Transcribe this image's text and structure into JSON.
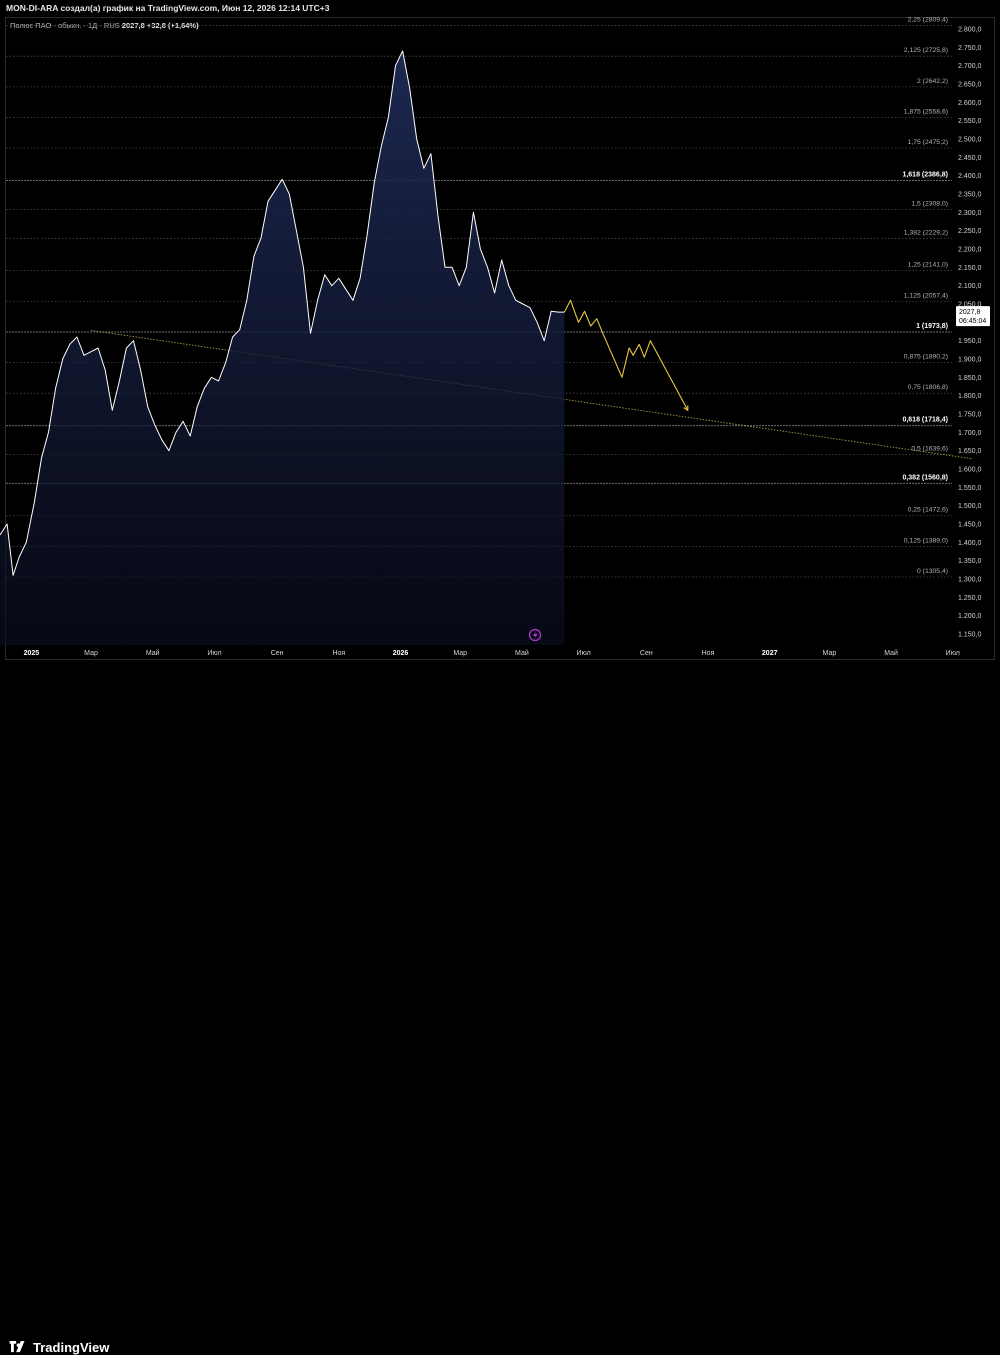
{
  "header": {
    "title": "MON-DI-ARA создал(а) график на TradingView.com, Июн 12, 2026 12:14 UTC+3"
  },
  "legend": {
    "symbol": "Полюс ПАО · обыкн. · 1Д · RUS",
    "last": "2027,8",
    "change": "+32,8 (+1,64%)"
  },
  "price_label": {
    "value": "2027,8",
    "countdown": "06:45:04"
  },
  "footer": {
    "brand": "TradingView"
  },
  "colors": {
    "background": "#000000",
    "price_line": "#ffffff",
    "area_fill_top": "#1e2a55",
    "projection": "#e8c840",
    "trendline": "#c9b448",
    "fib_line": "#3a3a3a",
    "lightning_badge": "#b539d6"
  },
  "chart_data": {
    "type": "area",
    "title": "",
    "y_axis_ticks": [
      "2.800,0",
      "2.750,0",
      "2.700,0",
      "2.650,0",
      "2.600,0",
      "2.550,0",
      "2.500,0",
      "2.450,0",
      "2.400,0",
      "2.350,0",
      "2.300,0",
      "2.250,0",
      "2.200,0",
      "2.150,0",
      "2.100,0",
      "2.050,0",
      "2.000,0",
      "1.950,0",
      "1.900,0",
      "1.850,0",
      "1.800,0",
      "1.750,0",
      "1.700,0",
      "1.650,0",
      "1.600,0",
      "1.550,0",
      "1.500,0",
      "1.450,0",
      "1.400,0",
      "1.350,0",
      "1.300,0",
      "1.250,0",
      "1.200,0",
      "1.150,0"
    ],
    "y_ticks_values": [
      2800,
      2750,
      2700,
      2650,
      2600,
      2550,
      2500,
      2450,
      2400,
      2350,
      2300,
      2250,
      2200,
      2150,
      2100,
      2050,
      2000,
      1950,
      1900,
      1850,
      1800,
      1750,
      1700,
      1650,
      1600,
      1550,
      1500,
      1450,
      1400,
      1350,
      1300,
      1250,
      1200,
      1150
    ],
    "ylim": [
      1120,
      2830
    ],
    "x_axis_labels": [
      "2025",
      "Мар",
      "Май",
      "Июл",
      "Сен",
      "Ноя",
      "2026",
      "Мар",
      "Май",
      "Июл",
      "Сен",
      "Ноя",
      "2027",
      "Мар",
      "Май",
      "Июл"
    ],
    "x_axis_label_dates": [
      "2025-01-01",
      "2025-03-01",
      "2025-05-01",
      "2025-07-01",
      "2025-09-01",
      "2025-11-01",
      "2026-01-01",
      "2026-03-01",
      "2026-05-01",
      "2026-07-01",
      "2026-09-01",
      "2026-11-01",
      "2027-01-01",
      "2027-03-01",
      "2027-05-01",
      "2027-07-01"
    ],
    "x_range": [
      "2024-12-01",
      "2027-07-20"
    ],
    "fib_levels": [
      {
        "label": "2,25 (2809,4)",
        "value": 2809.4,
        "highlight": false
      },
      {
        "label": "2,125 (2725,8)",
        "value": 2725.8,
        "highlight": false
      },
      {
        "label": "2 (2642,2)",
        "value": 2642.2,
        "highlight": false
      },
      {
        "label": "1,875 (2558,6)",
        "value": 2558.6,
        "highlight": false
      },
      {
        "label": "1,75 (2475,2)",
        "value": 2475.2,
        "highlight": false
      },
      {
        "label": "1,618 (2386,8)",
        "value": 2386.8,
        "highlight": true
      },
      {
        "label": "1,5 (2308,0)",
        "value": 2308.0,
        "highlight": false
      },
      {
        "label": "1,382 (2229,2)",
        "value": 2229.2,
        "highlight": false
      },
      {
        "label": "1,25 (2141,0)",
        "value": 2141.0,
        "highlight": false
      },
      {
        "label": "1,125 (2057,4)",
        "value": 2057.4,
        "highlight": false
      },
      {
        "label": "1 (1973,8)",
        "value": 1973.8,
        "highlight": true
      },
      {
        "label": "0,875 (1890,2)",
        "value": 1890.2,
        "highlight": false
      },
      {
        "label": "0,75 (1806,8)",
        "value": 1806.8,
        "highlight": false
      },
      {
        "label": "0,618 (1718,4)",
        "value": 1718.4,
        "highlight": true
      },
      {
        "label": "0,5 (1639,6)",
        "value": 1639.6,
        "highlight": false
      },
      {
        "label": "0,382 (1560,8)",
        "value": 1560.8,
        "highlight": true
      },
      {
        "label": "0,25 (1472,6)",
        "value": 1472.6,
        "highlight": false
      },
      {
        "label": "0,125 (1389,0)",
        "value": 1389.0,
        "highlight": false
      },
      {
        "label": "0 (1305,4)",
        "value": 1305.4,
        "highlight": false
      }
    ],
    "series": [
      {
        "style": "area",
        "x": [
          "2024-12-01",
          "2024-12-08",
          "2024-12-14",
          "2024-12-20",
          "2024-12-27",
          "2025-01-04",
          "2025-01-11",
          "2025-01-18",
          "2025-01-25",
          "2025-02-01",
          "2025-02-08",
          "2025-02-15",
          "2025-02-22",
          "2025-03-01",
          "2025-03-08",
          "2025-03-15",
          "2025-03-22",
          "2025-03-29",
          "2025-04-05",
          "2025-04-12",
          "2025-04-19",
          "2025-04-26",
          "2025-05-03",
          "2025-05-10",
          "2025-05-17",
          "2025-05-24",
          "2025-05-31",
          "2025-06-07",
          "2025-06-14",
          "2025-06-21",
          "2025-06-28",
          "2025-07-05",
          "2025-07-12",
          "2025-07-19",
          "2025-07-26",
          "2025-08-02",
          "2025-08-09",
          "2025-08-16",
          "2025-08-23",
          "2025-08-30",
          "2025-09-06",
          "2025-09-13",
          "2025-09-20",
          "2025-09-27",
          "2025-10-04",
          "2025-10-11",
          "2025-10-18",
          "2025-10-25",
          "2025-11-01",
          "2025-11-08",
          "2025-11-15",
          "2025-11-22",
          "2025-11-29",
          "2025-12-06",
          "2025-12-13",
          "2025-12-20",
          "2025-12-27",
          "2026-01-03",
          "2026-01-10",
          "2026-01-17",
          "2026-01-24",
          "2026-01-31",
          "2026-02-07",
          "2026-02-14",
          "2026-02-21",
          "2026-02-28",
          "2026-03-07",
          "2026-03-14",
          "2026-03-21",
          "2026-03-28",
          "2026-04-04",
          "2026-04-11",
          "2026-04-18",
          "2026-04-25",
          "2026-05-02",
          "2026-05-09",
          "2026-05-16",
          "2026-05-23",
          "2026-05-30",
          "2026-06-06",
          "2026-06-12"
        ],
        "y": [
          1420,
          1450,
          1310,
          1360,
          1400,
          1510,
          1630,
          1700,
          1820,
          1900,
          1940,
          1960,
          1910,
          1920,
          1930,
          1870,
          1760,
          1840,
          1930,
          1950,
          1870,
          1770,
          1720,
          1680,
          1650,
          1700,
          1730,
          1690,
          1770,
          1820,
          1850,
          1840,
          1890,
          1960,
          1980,
          2060,
          2180,
          2230,
          2330,
          2360,
          2390,
          2350,
          2250,
          2150,
          1970,
          2060,
          2130,
          2100,
          2120,
          2090,
          2060,
          2120,
          2240,
          2380,
          2480,
          2560,
          2700,
          2740,
          2640,
          2500,
          2420,
          2460,
          2290,
          2150,
          2150,
          2100,
          2150,
          2300,
          2200,
          2150,
          2080,
          2170,
          2100,
          2060,
          2050,
          2040,
          2000,
          1950,
          2030,
          2027.8,
          2027.8
        ]
      },
      {
        "style": "projection",
        "x": [
          "2026-06-12",
          "2026-06-18",
          "2026-06-26",
          "2026-07-02",
          "2026-07-08",
          "2026-07-14",
          "2026-07-20",
          "2026-08-08",
          "2026-08-15",
          "2026-08-19",
          "2026-08-25",
          "2026-08-30",
          "2026-09-05",
          "2026-10-12"
        ],
        "y": [
          2027.8,
          2060,
          2000,
          2030,
          1990,
          2010,
          1970,
          1850,
          1930,
          1910,
          1940,
          1905,
          1950,
          1760
        ]
      }
    ],
    "trendline": {
      "x": [
        "2025-03-01",
        "2027-07-20"
      ],
      "y": [
        1978,
        1628
      ]
    },
    "legend": "top-left",
    "grid": false
  }
}
